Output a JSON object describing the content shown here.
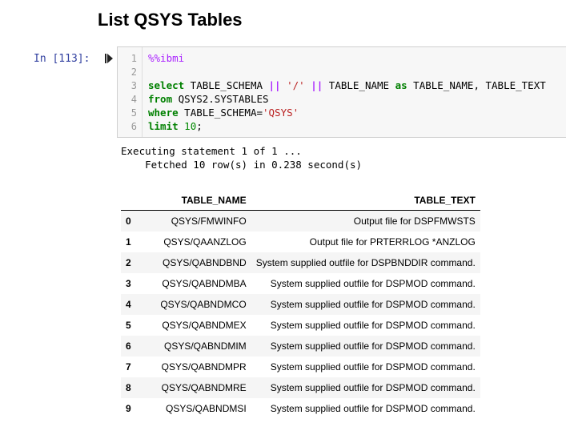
{
  "heading": "List QSYS Tables",
  "prompt": "In [113]:",
  "code": {
    "line_numbers": [
      "1",
      "2",
      "3",
      "4",
      "5",
      "6"
    ],
    "magic": "%%ibmi",
    "l3_kw": "select",
    "l3_a": " TABLE_SCHEMA ",
    "l3_op1": "||",
    "l3_sp1": " ",
    "l3_str": "'/'",
    "l3_sp2": " ",
    "l3_op2": "||",
    "l3_b": " TABLE_NAME ",
    "l3_as": "as",
    "l3_c": " TABLE_NAME, TABLE_TEXT",
    "l4_kw": "from",
    "l4_a": " QSYS2.SYSTABLES",
    "l5_kw": "where",
    "l5_a": " TABLE_SCHEMA=",
    "l5_str": "'QSYS'",
    "l6_kw": "limit",
    "l6_sp": " ",
    "l6_num": "10",
    "l6_end": ";"
  },
  "output": {
    "line1": "Executing statement 1 of 1 ...",
    "line2": "    Fetched 10 row(s) in 0.238 second(s)"
  },
  "table": {
    "columns": [
      "",
      "TABLE_NAME",
      "TABLE_TEXT"
    ],
    "rows": [
      [
        "0",
        "QSYS/FMWINFO",
        "Output file for DSPFMWSTS"
      ],
      [
        "1",
        "QSYS/QAANZLOG",
        "Output file for PRTERRLOG *ANZLOG"
      ],
      [
        "2",
        "QSYS/QABNDBND",
        "System supplied outfile for DSPBNDDIR command."
      ],
      [
        "3",
        "QSYS/QABNDMBA",
        "System supplied outfile for DSPMOD command."
      ],
      [
        "4",
        "QSYS/QABNDMCO",
        "System supplied outfile for DSPMOD command."
      ],
      [
        "5",
        "QSYS/QABNDMEX",
        "System supplied outfile for DSPMOD command."
      ],
      [
        "6",
        "QSYS/QABNDMIM",
        "System supplied outfile for DSPMOD command."
      ],
      [
        "7",
        "QSYS/QABNDMPR",
        "System supplied outfile for DSPMOD command."
      ],
      [
        "8",
        "QSYS/QABNDMRE",
        "System supplied outfile for DSPMOD command."
      ],
      [
        "9",
        "QSYS/QABNDMSI",
        "System supplied outfile for DSPMOD command."
      ]
    ]
  }
}
